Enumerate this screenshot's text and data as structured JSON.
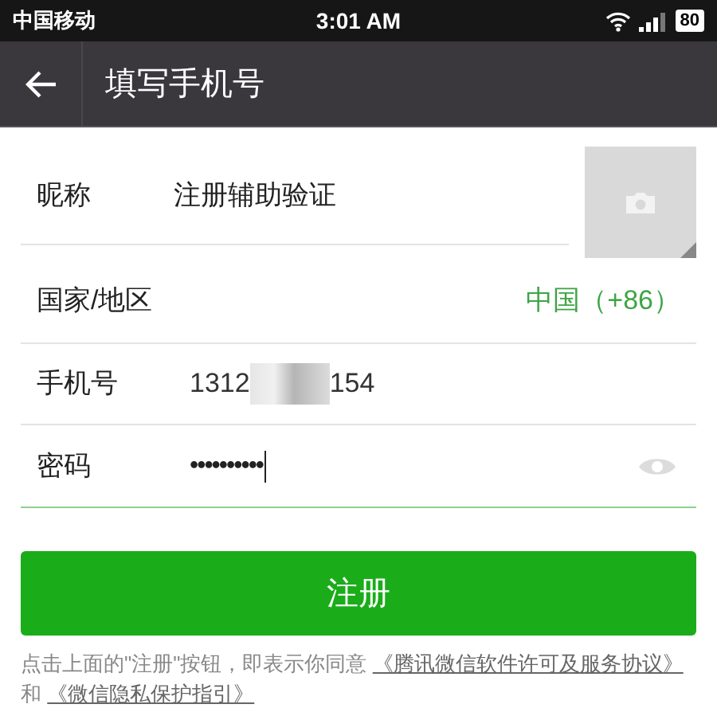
{
  "status_bar": {
    "carrier": "中国移动",
    "time": "3:01 AM",
    "battery": "80"
  },
  "header": {
    "title": "填写手机号"
  },
  "form": {
    "nickname": {
      "label": "昵称",
      "value": "注册辅助验证"
    },
    "country": {
      "label": "国家/地区",
      "value": "中国（+86）"
    },
    "phone": {
      "label": "手机号",
      "value_start": "1312",
      "value_end": "154"
    },
    "password": {
      "label": "密码",
      "value": "••••••••••",
      "focused": true
    }
  },
  "register_button": "注册",
  "agreement": {
    "text": "点击上面的\"注册\"按钮，即表示你同意",
    "link_1": "《腾讯微信软件许可及服务协议》",
    "conjunction": "和",
    "link_2": "《微信隐私保护指引》"
  }
}
